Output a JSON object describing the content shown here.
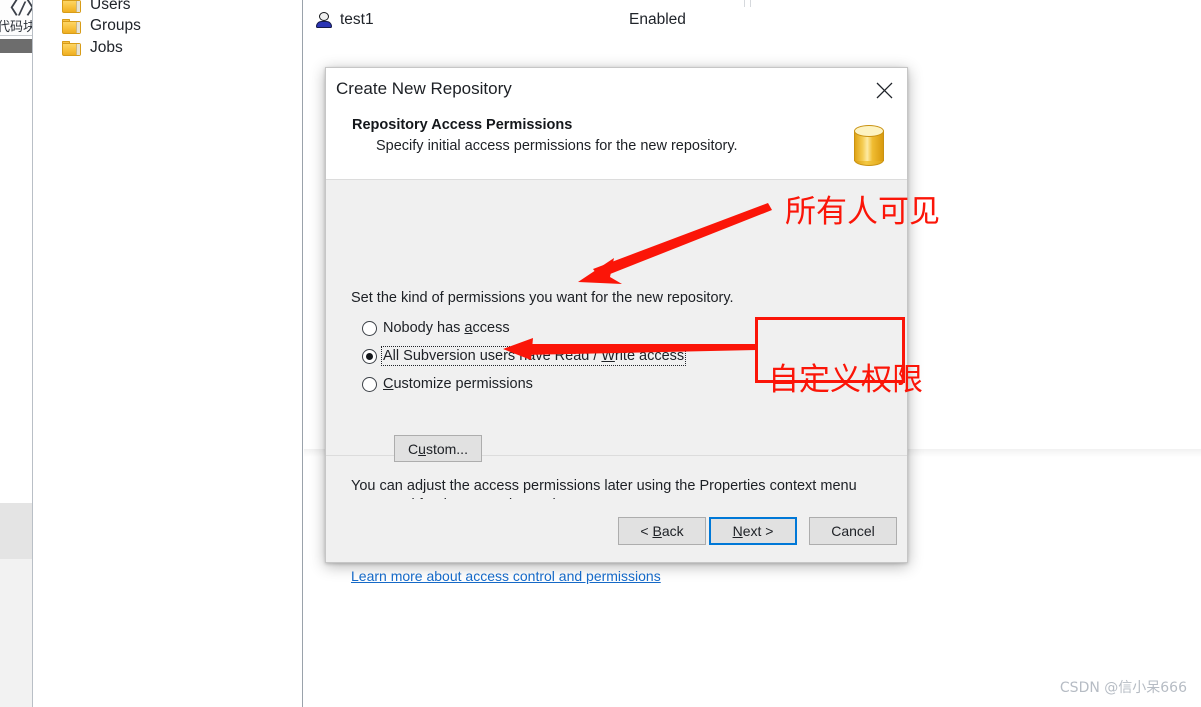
{
  "left_strip": {
    "code_icon": "code-block-icon",
    "code_glyph": "〈/〉",
    "code_label": "代码块"
  },
  "tree_panel": {
    "items": [
      {
        "label": "Users",
        "icon": "folder-icon"
      },
      {
        "label": "Groups",
        "icon": "folder-icon"
      },
      {
        "label": "Jobs",
        "icon": "folder-icon"
      }
    ]
  },
  "list_panel": {
    "row": {
      "icon": "user-icon",
      "name": "test1",
      "status": "Enabled"
    }
  },
  "dialog": {
    "title": "Create New Repository",
    "close_icon": "close-icon",
    "header": {
      "title": "Repository Access Permissions",
      "subtitle": "Specify initial access permissions for the new repository.",
      "icon": "database-cylinder-icon"
    },
    "prompt": "Set the kind of permissions you want for the new repository.",
    "options": [
      {
        "id": "nobody",
        "pre": "Nobody has ",
        "accel": "a",
        "post": "ccess",
        "selected": false,
        "focused": false
      },
      {
        "id": "all-subversion-users",
        "pre": "All Subversion users have Read / ",
        "accel": "W",
        "post": "rite access",
        "selected": true,
        "focused": true
      },
      {
        "id": "customize",
        "pre": "",
        "accel": "C",
        "post": "ustomize permissions",
        "selected": false,
        "focused": false
      }
    ],
    "custom_button": {
      "pre": "C",
      "accel": "u",
      "post": "stom..."
    },
    "note": "You can adjust the access permissions later using the Properties context menu command for the created repository.",
    "help_link": "Learn more about access control and permissions",
    "footer": {
      "back": {
        "pre": "< ",
        "accel": "B",
        "post": "ack"
      },
      "next": {
        "pre": "",
        "accel": "N",
        "post": "ext >"
      },
      "cancel": "Cancel"
    }
  },
  "annotations": {
    "note_1": "所有人可见",
    "note_2": "自定义权限",
    "color": "#fb1508"
  },
  "watermark": "CSDN @信小呆666"
}
